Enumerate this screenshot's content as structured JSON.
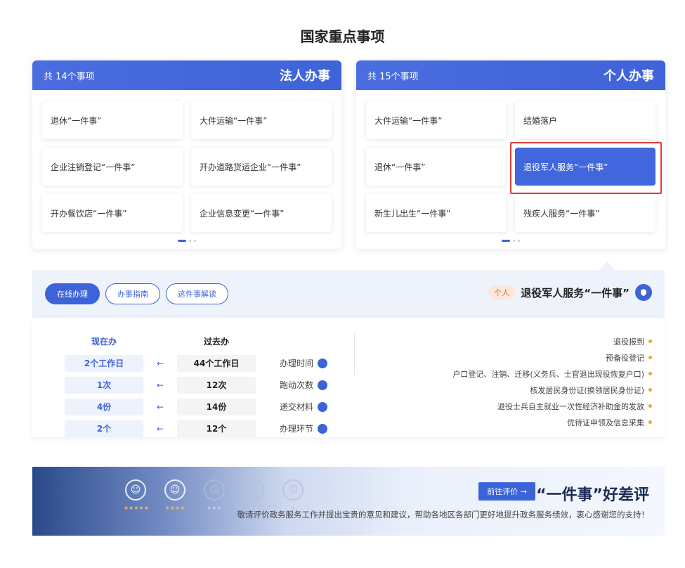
{
  "section_title": "国家重点事项",
  "cards": {
    "personal": {
      "title": "个人办事",
      "count": "共 15个事项",
      "items": [
        "结婚落户",
        "大件运输“一件事”",
        "退役军人服务“一件事”",
        "退休“一件事”",
        "残疾人服务“一件事”",
        "新生儿出生“一件事”"
      ]
    },
    "legal": {
      "title": "法人办事",
      "count": "共 14个事项",
      "items": [
        "大件运输“一件事”",
        "退休“一件事”",
        "开办道路货运企业“一件事”",
        "企业注销登记“一件事”",
        "企业信息变更“一件事”",
        "开办餐饮店“一件事”"
      ]
    }
  },
  "detail": {
    "name": "退役军人服务“一件事”",
    "tag": "个人",
    "buttons": {
      "online": "在线办理",
      "guide": "办事指南",
      "policy": "这件事解读"
    },
    "requirements": [
      "退役报到",
      "预备役登记",
      "户口登记、注销、迁移(义务兵、士官退出现役恢复户口)",
      "核发居民身份证(换领居民身份证)",
      "退役士兵自主就业一次性经济补助金的发放",
      "优待证申领及信息采集"
    ],
    "compare": {
      "before_head": "过去办",
      "after_head": "现在办",
      "rows": [
        {
          "label": "办理时间",
          "before": "44个工作日",
          "after": "2个工作日"
        },
        {
          "label": "跑动次数",
          "before": "12次",
          "after": "1次"
        },
        {
          "label": "递交材料",
          "before": "14份",
          "after": "4份"
        },
        {
          "label": "办理环节",
          "before": "12个",
          "after": "2个"
        }
      ]
    }
  },
  "banner": {
    "title": "“一件事”好差评",
    "button": "前往评价 →",
    "desc": "敬请评价政务服务工作并提出宝贵的意见和建议，帮助各地区各部门更好地提升政务服务绩效，衷心感谢您的支持！",
    "stars": [
      "★★★★★",
      "★★★★",
      "★★★",
      "★★",
      "★"
    ]
  },
  "colors": {
    "accent": "#3d63d8",
    "highlight": "#e03b3b",
    "tag": "#e6673b"
  }
}
